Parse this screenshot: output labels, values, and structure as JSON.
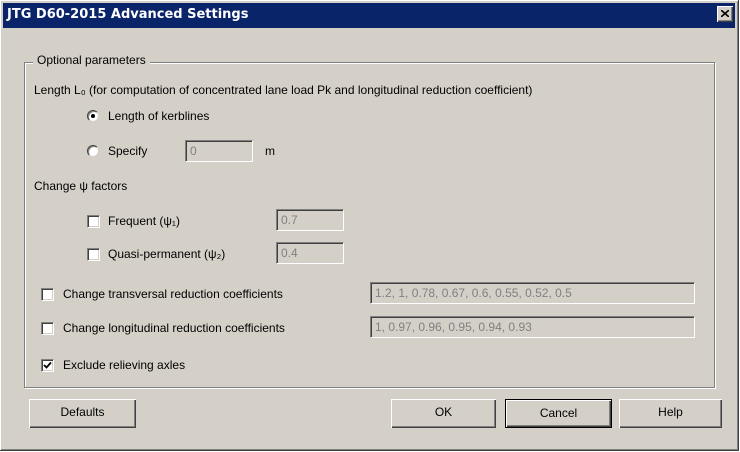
{
  "window": {
    "title": "JTG D60-2015 Advanced Settings"
  },
  "group": {
    "legend": "Optional parameters"
  },
  "length": {
    "heading": "Length L₀ (for computation of concentrated lane load Pk and longitudinal reduction coefficient)",
    "option_kerblines": "Length of kerblines",
    "option_specify": "Specify",
    "specify_value": "0",
    "specify_unit": "m",
    "selected": "kerblines"
  },
  "psi": {
    "heading": "Change ψ factors",
    "frequent_label": "Frequent  (ψ₁)",
    "frequent_value": "0.7",
    "frequent_checked": false,
    "quasi_label": "Quasi-permanent  (ψ₂)",
    "quasi_value": "0.4",
    "quasi_checked": false
  },
  "transversal": {
    "label": "Change transversal reduction coefficients",
    "value": "1.2, 1, 0.78, 0.67, 0.6, 0.55, 0.52, 0.5",
    "checked": false
  },
  "longitudinal": {
    "label": "Change longitudinal reduction coefficients",
    "value": "1, 0.97, 0.96, 0.95, 0.94, 0.93",
    "checked": false
  },
  "relieving": {
    "label": "Exclude relieving axles",
    "checked": true
  },
  "buttons": {
    "defaults": "Defaults",
    "ok": "OK",
    "cancel": "Cancel",
    "help": "Help"
  },
  "icons": {
    "close": "close-icon",
    "check": "checkmark-icon"
  },
  "colors": {
    "titlebar": "#0a246a",
    "face": "#d4d0c8"
  }
}
